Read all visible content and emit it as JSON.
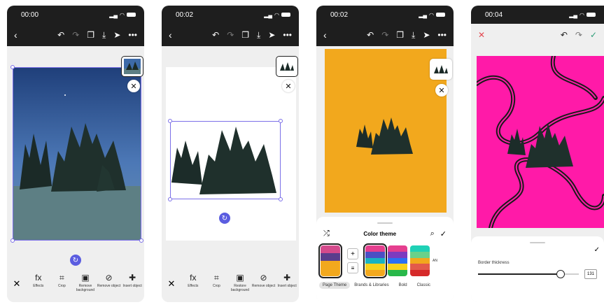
{
  "icons": {
    "back": "chevron-left-icon",
    "undo": "undo-icon",
    "redo": "redo-icon",
    "layers": "layers-icon",
    "download": "download-icon",
    "share": "send-icon",
    "more": "more-icon",
    "close": "close-icon",
    "rotate": "rotate-icon",
    "check": "check-icon",
    "shuffle": "shuffle-icon",
    "search": "search-icon"
  },
  "colors": {
    "accent": "#7b6fe8",
    "toolbar": "#1e1e1e",
    "orange_bg": "#f2a81d",
    "pink_bg": "#ff1aa8"
  },
  "screens": [
    {
      "time": "00:00",
      "tools": [
        {
          "icon": "fx",
          "label": "Effects"
        },
        {
          "icon": "⌗",
          "label": "Crop"
        },
        {
          "icon": "▣",
          "label": "Remove background"
        },
        {
          "icon": "⊘",
          "label": "Remove object"
        },
        {
          "icon": "✚",
          "label": "Insert object"
        }
      ]
    },
    {
      "time": "00:02",
      "tools": [
        {
          "icon": "fx",
          "label": "Effects"
        },
        {
          "icon": "⌗",
          "label": "Crop"
        },
        {
          "icon": "▣",
          "label": "Restore background"
        },
        {
          "icon": "⊘",
          "label": "Remove object"
        },
        {
          "icon": "✚",
          "label": "Insert object"
        }
      ]
    },
    {
      "time": "00:02",
      "sheet_title": "Color theme",
      "theme_tabs": [
        "Page Theme",
        "Brands & Libraries",
        "Bold",
        "Classic"
      ],
      "side_letters": "AN"
    },
    {
      "time": "00:04",
      "slider_label": "Border thickness",
      "slider_value": "131",
      "slider_fraction": 0.82
    }
  ]
}
